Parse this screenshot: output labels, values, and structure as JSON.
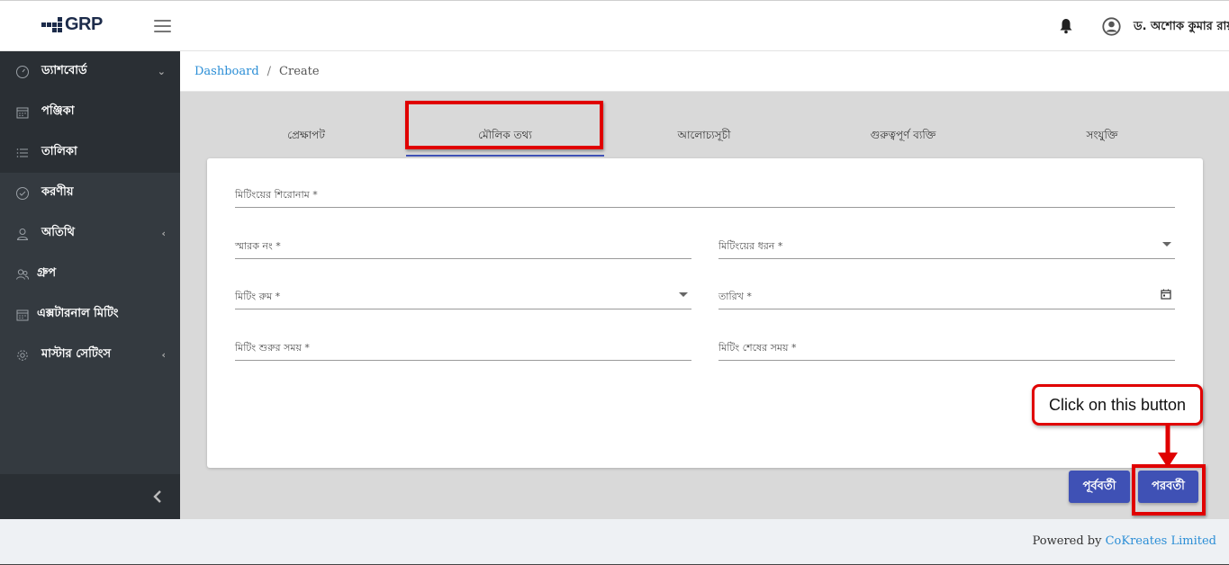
{
  "app": {
    "logo_text": "GRP",
    "user_name": "ড. অশোক কুমার রায়"
  },
  "breadcrumb": {
    "root": "Dashboard",
    "separator": "/",
    "current": "Create"
  },
  "sidebar": {
    "items": [
      {
        "label": "ড্যাশবোর্ড",
        "icon": "speedometer-icon",
        "caret": "⌄"
      },
      {
        "label": "পঞ্জিকা",
        "icon": "calendar-icon",
        "caret": ""
      },
      {
        "label": "তালিকা",
        "icon": "list-icon",
        "caret": ""
      },
      {
        "label": "করণীয়",
        "icon": "check-circle-icon",
        "caret": ""
      },
      {
        "label": "অতিথি",
        "icon": "user-icon",
        "caret": "‹"
      },
      {
        "label": "গ্রুপ",
        "icon": "group-icon",
        "caret": ""
      },
      {
        "label": "এক্সটারনাল মিটিং",
        "icon": "calendar-icon",
        "caret": ""
      },
      {
        "label": "মাস্টার সেটিংস",
        "icon": "gear-icon",
        "caret": "‹"
      }
    ]
  },
  "tabs": [
    {
      "label": "প্রেক্ষাপট"
    },
    {
      "label": "মৌলিক তথ্য"
    },
    {
      "label": "আলোচ্যসূচী"
    },
    {
      "label": "গুরুত্বপূর্ণ ব্যক্তি"
    },
    {
      "label": "সংযুক্তি"
    }
  ],
  "form": {
    "meeting_title": "মিটিংয়ের শিরোনাম  *",
    "memo_no": "স্মারক নং *",
    "meeting_type": "মিটিংয়ের ধরন *",
    "meeting_room": "মিটিং রুম *",
    "date": "তারিখ *",
    "start_time": "মিটিং শুরুর সময়  *",
    "end_time": "মিটিং শেষের সময়  *"
  },
  "buttons": {
    "previous": "পূর্ববর্তী",
    "next": "পরবর্তী"
  },
  "annotation": {
    "callout_text": "Click on this button",
    "highlight_color": "#e00000"
  },
  "footer": {
    "powered_by": "Powered by ",
    "company": "CoKreates Limited"
  },
  "colors": {
    "primary": "#3f51b5",
    "sidebar_bg": "#343a40",
    "link": "#2b8ed6"
  }
}
